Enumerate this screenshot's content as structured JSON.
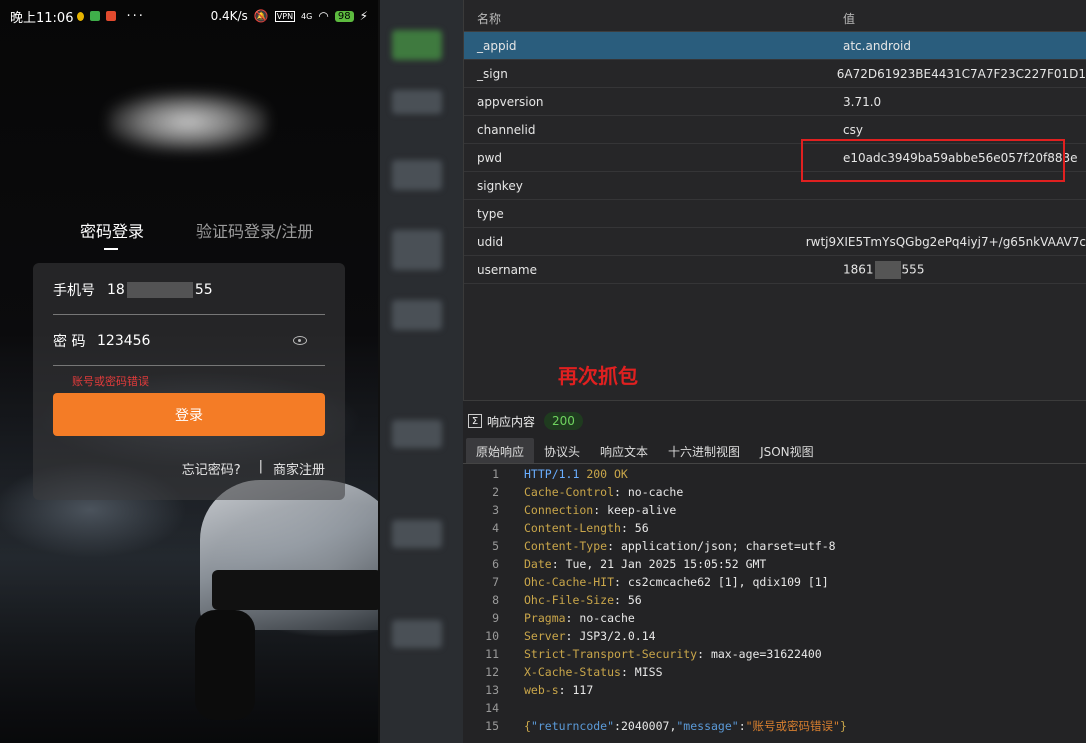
{
  "status_bar": {
    "time": "晚上11:06",
    "speed": "0.4K/s",
    "net": "VPN",
    "signal": "4G",
    "battery": "98"
  },
  "login": {
    "tab_password": "密码登录",
    "tab_sms": "验证码登录/注册",
    "phone_label": "手机号",
    "phone_prefix": "18",
    "phone_suffix": "55",
    "password_label": "密 码",
    "password_value": "123456",
    "error": "账号或密码错误",
    "login_button": "登录",
    "forgot": "忘记密码?",
    "separator": "|",
    "merchant": "商家注册"
  },
  "table": {
    "headers": {
      "name": "名称",
      "value": "值"
    },
    "rows": [
      {
        "name": "_appid",
        "value": "atc.android"
      },
      {
        "name": "_sign",
        "value": "6A72D61923BE4431C7A7F23C227F01D1"
      },
      {
        "name": "appversion",
        "value": "3.71.0"
      },
      {
        "name": "channelid",
        "value": "csy"
      },
      {
        "name": "pwd",
        "value": "e10adc3949ba59abbe56e057f20f883e"
      },
      {
        "name": "signkey",
        "value": ""
      },
      {
        "name": "type",
        "value": ""
      },
      {
        "name": "udid",
        "value": "rwtj9XIE5TmYsQGbg2ePq4iyj7+/g65nkVAAV7c"
      },
      {
        "name": "username",
        "value_prefix": "1861",
        "value_suffix": "555"
      }
    ],
    "annotation": "再次抓包"
  },
  "response": {
    "title": "响应内容",
    "status_code": "200",
    "tabs": [
      "原始响应",
      "协议头",
      "响应文本",
      "十六进制视图",
      "JSON视图"
    ],
    "lines": [
      {
        "n": "1",
        "k": "HTTP/1.1",
        "v": " 200 OK",
        "kind": "status"
      },
      {
        "n": "2",
        "k": "Cache-Control",
        "v": "no-cache"
      },
      {
        "n": "3",
        "k": "Connection",
        "v": "keep-alive"
      },
      {
        "n": "4",
        "k": "Content-Length",
        "v": "56"
      },
      {
        "n": "5",
        "k": "Content-Type",
        "v": "application/json; charset=utf-8"
      },
      {
        "n": "6",
        "k": "Date",
        "v": "Tue, 21 Jan 2025 15:05:52 GMT"
      },
      {
        "n": "7",
        "k": "Ohc-Cache-HIT",
        "v": "cs2cmcache62 [1], qdix109 [1]"
      },
      {
        "n": "8",
        "k": "Ohc-File-Size",
        "v": "56"
      },
      {
        "n": "9",
        "k": "Pragma",
        "v": "no-cache"
      },
      {
        "n": "10",
        "k": "Server",
        "v": "JSP3/2.0.14"
      },
      {
        "n": "11",
        "k": "Strict-Transport-Security",
        "v": "max-age=31622400"
      },
      {
        "n": "12",
        "k": "X-Cache-Status",
        "v": "MISS"
      },
      {
        "n": "13",
        "k": "web-s",
        "v": "117"
      },
      {
        "n": "14",
        "k": "",
        "v": "",
        "kind": "blank"
      },
      {
        "n": "15",
        "k": "",
        "v": "",
        "kind": "json",
        "json": {
          "returncode_key": "\"returncode\"",
          "returncode_val": "2040007",
          "message_key": "\"message\"",
          "message_val": "\"账号或密码错误\""
        }
      }
    ]
  }
}
